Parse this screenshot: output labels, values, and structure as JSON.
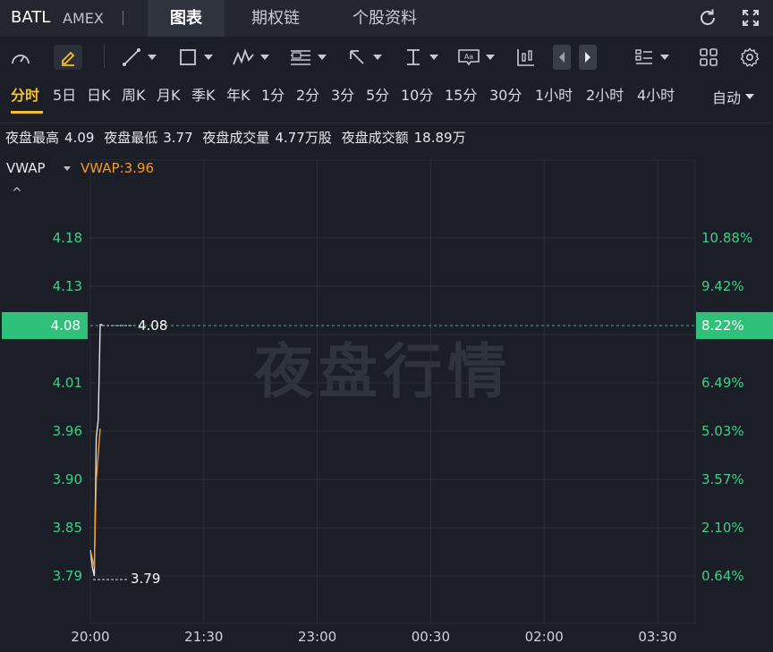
{
  "header": {
    "symbol": "BATL",
    "exchange": "AMEX",
    "tabs": [
      {
        "label": "图表",
        "active": true
      },
      {
        "label": "期权链",
        "active": false
      },
      {
        "label": "个股资料",
        "active": false
      }
    ],
    "icons": [
      "refresh-icon",
      "fullscreen-icon"
    ]
  },
  "toolbar": {
    "tools": [
      "gauge-icon",
      "pencil-icon",
      "trendline-icon",
      "rectangle-icon",
      "pattern-icon",
      "fibonacci-icon",
      "arrow-icon",
      "price-range-icon",
      "text-icon",
      "candle-icon",
      "prev-icon",
      "next-icon",
      "layout-list-icon",
      "grid-icon",
      "settings-icon"
    ]
  },
  "periods": {
    "items": [
      "分时",
      "5日",
      "日K",
      "周K",
      "月K",
      "季K",
      "年K",
      "1分",
      "2分",
      "3分",
      "5分",
      "10分",
      "15分",
      "30分",
      "1小时",
      "2小时",
      "4小时"
    ],
    "active": "分时",
    "mode": "自动"
  },
  "stats": {
    "items": [
      {
        "label": "夜盘最高",
        "value": "4.09"
      },
      {
        "label": "夜盘最低",
        "value": "3.77"
      },
      {
        "label": "夜盘成交量",
        "value": "4.77万股"
      },
      {
        "label": "夜盘成交额",
        "value": "18.89万"
      }
    ]
  },
  "indicator": {
    "name": "VWAP",
    "value_text": "VWAP:3.96"
  },
  "chart_data": {
    "type": "line",
    "title": "",
    "watermark": "夜盘行情",
    "x_ticks": [
      "20:00",
      "21:30",
      "23:00",
      "00:30",
      "02:00",
      "03:30"
    ],
    "y_ticks_left": [
      "4.18",
      "4.13",
      "4.07",
      "4.01",
      "3.96",
      "3.90",
      "3.85",
      "3.79"
    ],
    "y_ticks_right": [
      "10.88%",
      "9.42%",
      "7.95%",
      "6.49%",
      "5.03%",
      "3.57%",
      "2.10%",
      "0.64%"
    ],
    "ylim": [
      3.745,
      4.233
    ],
    "current_price": "4.08",
    "current_pct": "8.22%",
    "high_label": "4.08",
    "low_label": "3.79",
    "colors": {
      "price": "#e0e2e6",
      "vwap": "#f29a2e",
      "up": "#2fc079",
      "grid": "#2b2e37"
    },
    "series": [
      {
        "name": "价格",
        "points": [
          {
            "t": "20:00",
            "v": 3.82
          },
          {
            "t": "20:01",
            "v": 3.8
          },
          {
            "t": "20:02",
            "v": 3.79
          },
          {
            "t": "20:03",
            "v": 3.95
          },
          {
            "t": "20:04",
            "v": 3.97
          },
          {
            "t": "20:05",
            "v": 4.08
          },
          {
            "t": "20:06",
            "v": 4.08
          }
        ]
      },
      {
        "name": "VWAP",
        "points": [
          {
            "t": "20:00",
            "v": 3.82
          },
          {
            "t": "20:01",
            "v": 3.81
          },
          {
            "t": "20:02",
            "v": 3.8
          },
          {
            "t": "20:03",
            "v": 3.9
          },
          {
            "t": "20:04",
            "v": 3.93
          },
          {
            "t": "20:05",
            "v": 3.96
          }
        ]
      }
    ]
  }
}
